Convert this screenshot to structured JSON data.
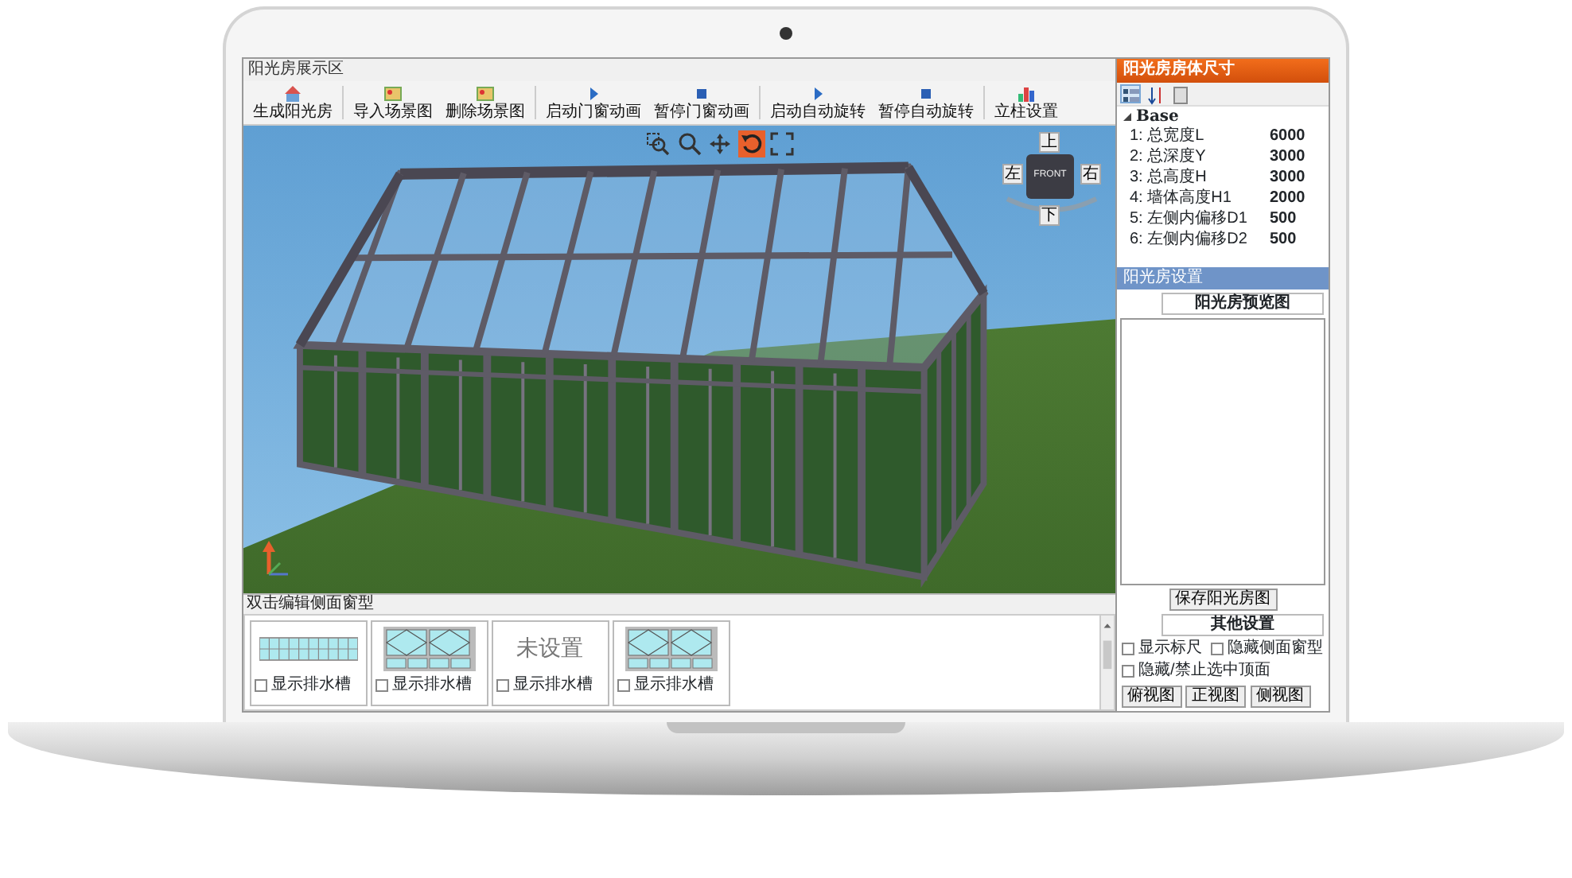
{
  "screen_title": "阳光房展示区",
  "toolbar": [
    [
      "生成阳光房"
    ],
    [
      "导入场景图",
      "删除场景图"
    ],
    [
      "启动门窗动画",
      "暂停门窗动画"
    ],
    [
      "启动自动旋转",
      "暂停自动旋转"
    ],
    [
      "立柱设置"
    ]
  ],
  "view_tools": [
    {
      "selected": false
    },
    {
      "selected": false
    },
    {
      "selected": false
    },
    {
      "selected": true
    },
    {
      "selected": false
    }
  ],
  "view_cube": {
    "top": "上",
    "left": "左",
    "right": "右",
    "bottom": "下",
    "face": "FRONT"
  },
  "bottom_panel": {
    "title": "双击编辑侧面窗型",
    "thumbnails": [
      {
        "kind": "grid",
        "label": "显示排水槽",
        "checked": false
      },
      {
        "kind": "casement",
        "label": "显示排水槽",
        "checked": false
      },
      {
        "kind": "unset",
        "text": "未设置",
        "label": "显示排水槽",
        "checked": false
      },
      {
        "kind": "casement",
        "label": "显示排水槽",
        "checked": false
      }
    ]
  },
  "properties": {
    "title": "阳光房房体尺寸",
    "tabs": [
      {
        "selected": true
      },
      {
        "selected": false
      },
      {
        "selected": false
      }
    ],
    "group": "Base",
    "expanded": true,
    "rows": [
      {
        "name": "1: 总宽度L",
        "value": "6000"
      },
      {
        "name": "2: 总深度Y",
        "value": "3000"
      },
      {
        "name": "3: 总高度H",
        "value": "3000"
      },
      {
        "name": "4: 墙体高度H1",
        "value": "2000"
      },
      {
        "name": "5: 左侧内偏移D1",
        "value": "500"
      },
      {
        "name": "6: 左侧内偏移D2",
        "value": "500"
      }
    ]
  },
  "settings": {
    "title": "阳光房设置",
    "preview_label": "阳光房预览图",
    "save_button": "保存阳光房图",
    "other_label": "其他设置",
    "options": [
      {
        "label": "显示标尺",
        "checked": false
      },
      {
        "label": "隐藏侧面窗型",
        "checked": false
      },
      {
        "label": "隐藏/禁止选中顶面",
        "checked": false
      }
    ],
    "view_buttons": [
      "俯视图",
      "正视图",
      "侧视图"
    ]
  }
}
